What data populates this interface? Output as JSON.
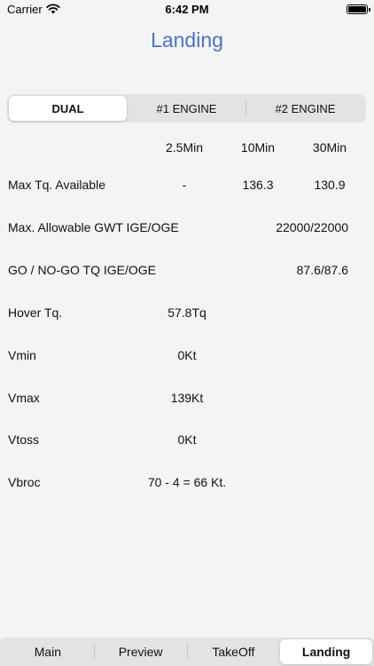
{
  "status_bar": {
    "carrier": "Carrier",
    "time": "6:42 PM"
  },
  "title": "Landing",
  "segments": [
    {
      "label": "DUAL"
    },
    {
      "label": "#1 ENGINE"
    },
    {
      "label": "#2 ENGINE"
    }
  ],
  "selected_segment": "DUAL",
  "columns": {
    "c1": "2.5Min",
    "c2": "10Min",
    "c3": "30Min"
  },
  "rows": {
    "max_tq": {
      "label": "Max Tq. Available",
      "v1": "-",
      "v2": "136.3",
      "v3": "130.9"
    },
    "max_gwt": {
      "label": "Max. Allowable GWT IGE/OGE",
      "value": "22000/22000"
    },
    "go_nogo": {
      "label": "GO / NO-GO TQ IGE/OGE",
      "value": "87.6/87.6"
    },
    "hover_tq": {
      "label": "Hover Tq.",
      "value": "57.8Tq"
    },
    "vmin": {
      "label": "Vmin",
      "value": "0Kt"
    },
    "vmax": {
      "label": "Vmax",
      "value": "139Kt"
    },
    "vtoss": {
      "label": "Vtoss",
      "value": "0Kt"
    },
    "vbroc": {
      "label": "Vbroc",
      "value": "70 - 4 = 66 Kt."
    }
  },
  "tabs": [
    {
      "label": "Main"
    },
    {
      "label": "Preview"
    },
    {
      "label": "TakeOff"
    },
    {
      "label": "Landing"
    }
  ],
  "selected_tab": "Landing"
}
